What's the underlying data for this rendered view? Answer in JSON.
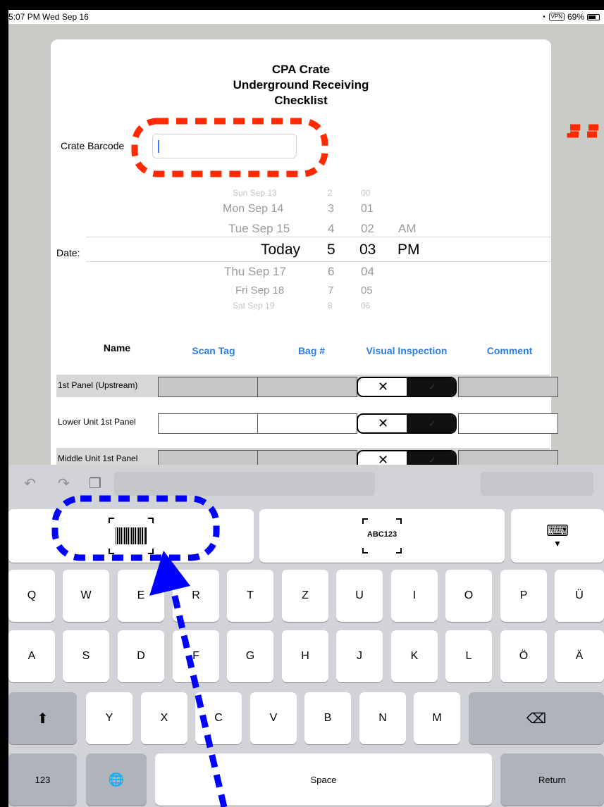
{
  "status_bar": {
    "time": "5:07 PM  Wed Sep 16",
    "vpn": "VPN",
    "battery": "69%"
  },
  "form": {
    "title_lines": [
      "CPA Crate",
      "Underground Receiving",
      "Checklist"
    ],
    "barcode_label": "Crate Barcode",
    "barcode_value": "",
    "date_label": "Date:",
    "picker": {
      "days": [
        "Sun Sep 13",
        "Mon Sep 14",
        "Tue Sep 15",
        "Today",
        "Thu Sep 17",
        "Fri Sep 18",
        "Sat Sep 19"
      ],
      "hours": [
        "2",
        "3",
        "4",
        "5",
        "6",
        "7",
        "8"
      ],
      "minutes": [
        "00",
        "01",
        "02",
        "03",
        "04",
        "05",
        "06"
      ],
      "ampm": [
        "AM",
        "PM"
      ],
      "selected": {
        "day": "Today",
        "hour": "5",
        "minute": "03",
        "ampm": "PM"
      }
    },
    "columns": [
      "Name",
      "Scan Tag",
      "Bag #",
      "Visual Inspection",
      "Comment"
    ],
    "rows": [
      {
        "name": "1st Panel (Upstream)",
        "inspection_reject": "✕",
        "inspection_accept": "✓"
      },
      {
        "name": "Lower Unit 1st Panel",
        "inspection_reject": "✕",
        "inspection_accept": "✓"
      },
      {
        "name": "Middle Unit 1st Panel",
        "inspection_reject": "✕",
        "inspection_accept": "✓"
      }
    ]
  },
  "keyboard": {
    "toolbar": {
      "undo_icon": "undo-icon",
      "redo_icon": "redo-icon",
      "paste_icon": "paste-icon"
    },
    "scan_barcode_icon": "barcode-scan-icon",
    "scan_text_label": "ABC123",
    "hide_keyboard_icon": "keyboard-hide-icon",
    "row1": [
      "Q",
      "W",
      "E",
      "R",
      "T",
      "Z",
      "U",
      "I",
      "O",
      "P",
      "Ü"
    ],
    "row2": [
      "A",
      "S",
      "D",
      "F",
      "G",
      "H",
      "J",
      "K",
      "L",
      "Ö",
      "Ä"
    ],
    "row3": [
      "Y",
      "X",
      "C",
      "V",
      "B",
      "N",
      "M"
    ],
    "numbers_label": "123",
    "space_label": "Space",
    "return_label": "Return"
  },
  "annotations": {
    "highlight_color": "#ff2a00",
    "pointer_color": "#0000ff"
  }
}
